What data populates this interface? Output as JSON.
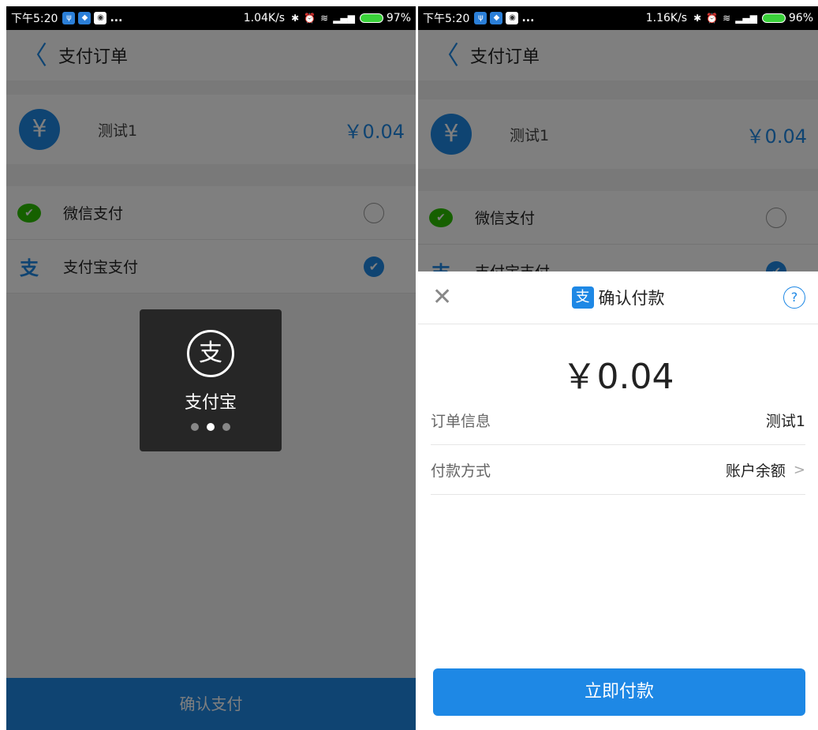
{
  "left": {
    "status": {
      "time": "下午5:20",
      "dots": "...",
      "net": "1.04K/s",
      "battery": "97%"
    },
    "header": {
      "back": "〈",
      "title": "支付订单"
    },
    "order": {
      "name": "测试1",
      "price": "￥0.04"
    },
    "methods": [
      {
        "label": "微信支付",
        "checked": false
      },
      {
        "label": "支付宝支付",
        "checked": true
      }
    ],
    "confirm_label": "确认支付",
    "loading": {
      "label": "支付宝"
    }
  },
  "right": {
    "status": {
      "time": "下午5:20",
      "dots": "...",
      "net": "1.16K/s",
      "battery": "96%"
    },
    "header": {
      "back": "〈",
      "title": "支付订单"
    },
    "order": {
      "name": "测试1",
      "price": "￥0.04"
    },
    "methods": [
      {
        "label": "微信支付",
        "checked": false
      },
      {
        "label": "支付宝支付",
        "checked": true
      }
    ],
    "sheet": {
      "title": "确认付款",
      "amount": "￥0.04",
      "rows": [
        {
          "key": "订单信息",
          "value": "测试1"
        },
        {
          "key": "付款方式",
          "value": "账户余额"
        }
      ],
      "pay_button": "立即付款"
    }
  },
  "colors": {
    "accent": "#1e88e5",
    "wechat": "#2dc100"
  },
  "icons": {
    "back": "chevron-left-icon",
    "close": "close-icon",
    "help": "help-icon",
    "alipay": "alipay-icon",
    "wechat": "wechat-icon"
  }
}
